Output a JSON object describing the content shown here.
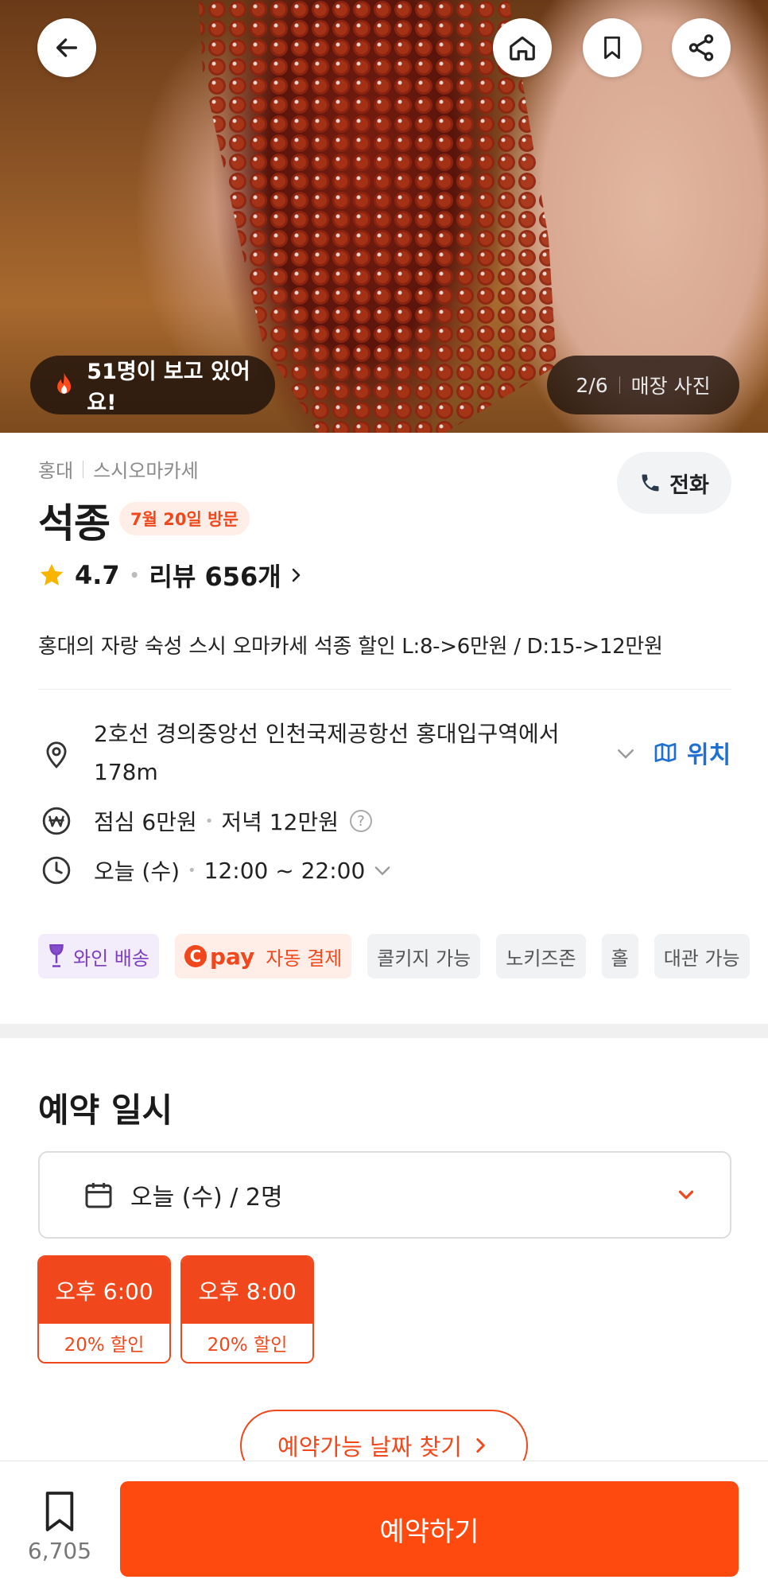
{
  "hero": {
    "watchers": "51명이 보고 있어요!",
    "photo_counter": "2/6",
    "photo_label": "매장 사진"
  },
  "store": {
    "area": "홍대",
    "category": "스시오마카세",
    "name": "석종",
    "visit_badge": "7월 20일 방문",
    "rating": "4.7",
    "reviews": "리뷰 656개",
    "call_label": "전화",
    "description": "홍대의 자랑 숙성 스시 오마카세 석종 할인 L:8->6만원 / D:15->12만원"
  },
  "info": {
    "address": "2호선 경의중앙선 인천국제공항선 홍대입구역에서 178m",
    "location_label": "위치",
    "price_lunch": "점심 6만원",
    "price_dinner": "저녁 12만원",
    "help_symbol": "?",
    "hours_day": "오늘 (수)",
    "hours_time": "12:00 ~ 22:00"
  },
  "tags": {
    "wine": "와인 배송",
    "pay_logo_c": "C",
    "pay_logo_text": "pay",
    "pay": "자동 결제",
    "corkage": "콜키지 가능",
    "nokids": "노키즈존",
    "hall": "홀",
    "rental": "대관 가능"
  },
  "reservation": {
    "title": "예약 일시",
    "selected": "오늘 (수) / 2명",
    "slots": [
      {
        "time": "오후 6:00",
        "discount": "20% 할인"
      },
      {
        "time": "오후 8:00",
        "discount": "20% 할인"
      }
    ],
    "find_dates": "예약가능 날짜 찾기"
  },
  "bottom": {
    "save_count": "6,705",
    "reserve_label": "예약하기"
  },
  "colors": {
    "accent": "#ff4a0f",
    "link": "#1f6fd1",
    "wine": "#7b3fc4"
  }
}
